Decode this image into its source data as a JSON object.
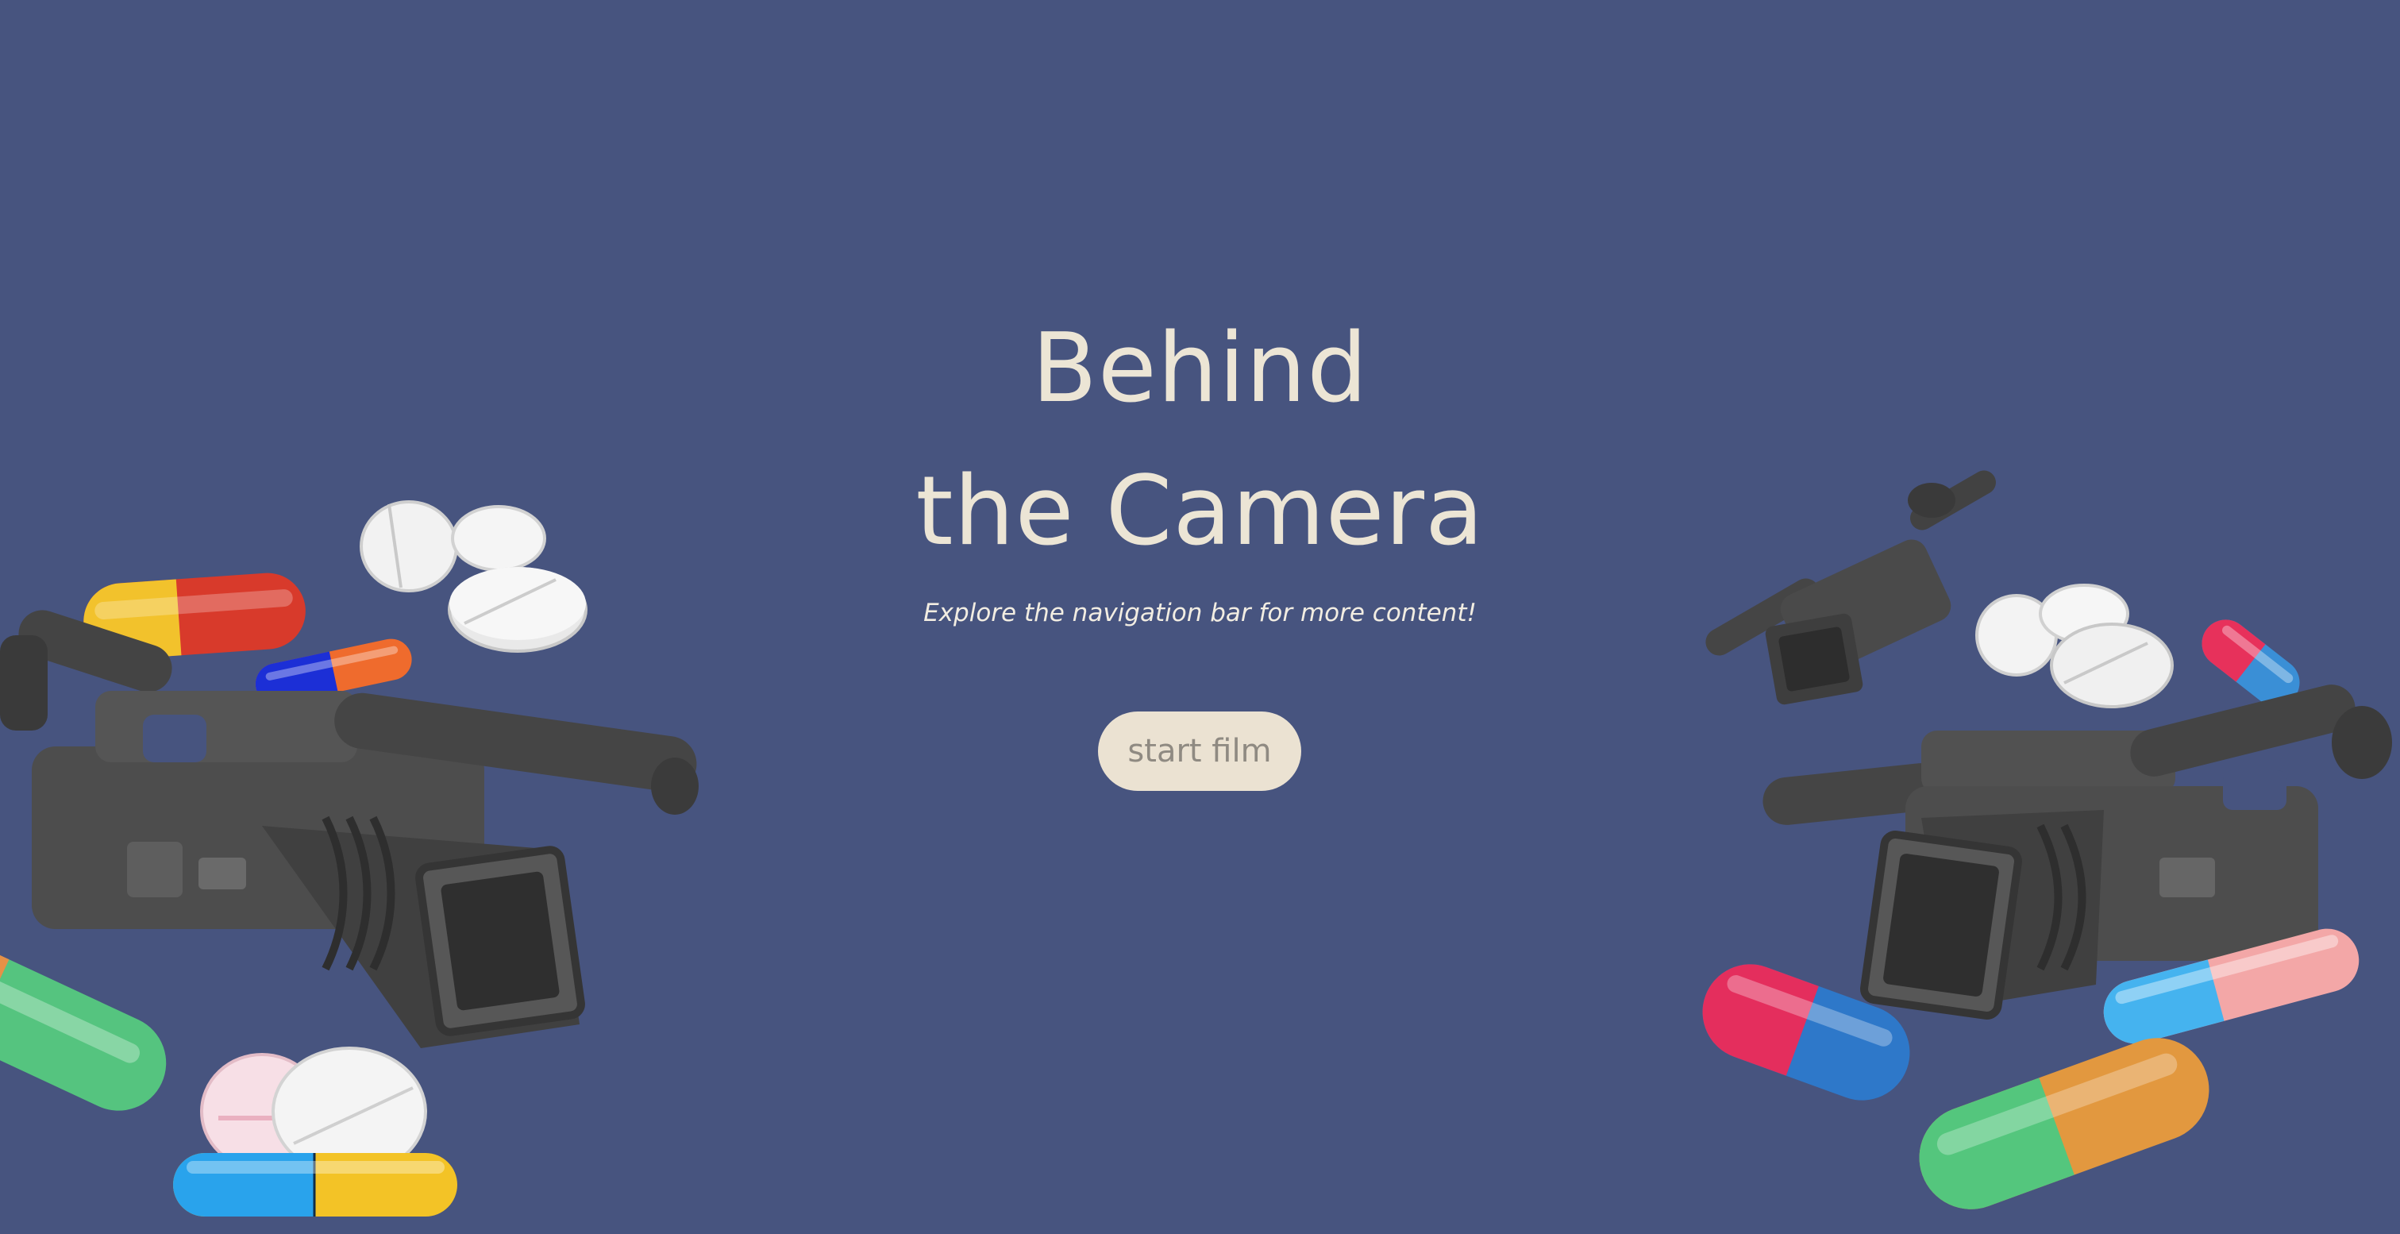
{
  "hero": {
    "title_line1": "Behind",
    "title_line2": "the Camera",
    "subtitle": "Explore the navigation bar for more content!",
    "start_button_label": "start film"
  },
  "decorations": {
    "left_cluster": [
      "camcorder-illustration",
      "pill-capsule-icon",
      "tablet-pill-icon"
    ],
    "right_cluster": [
      "camcorder-illustration",
      "pill-capsule-icon",
      "tablet-pill-icon"
    ]
  },
  "colors": {
    "background": "#47547f",
    "title": "#ece5d5",
    "button_bg": "#ebe2d2",
    "button_text": "#8f8a82"
  }
}
